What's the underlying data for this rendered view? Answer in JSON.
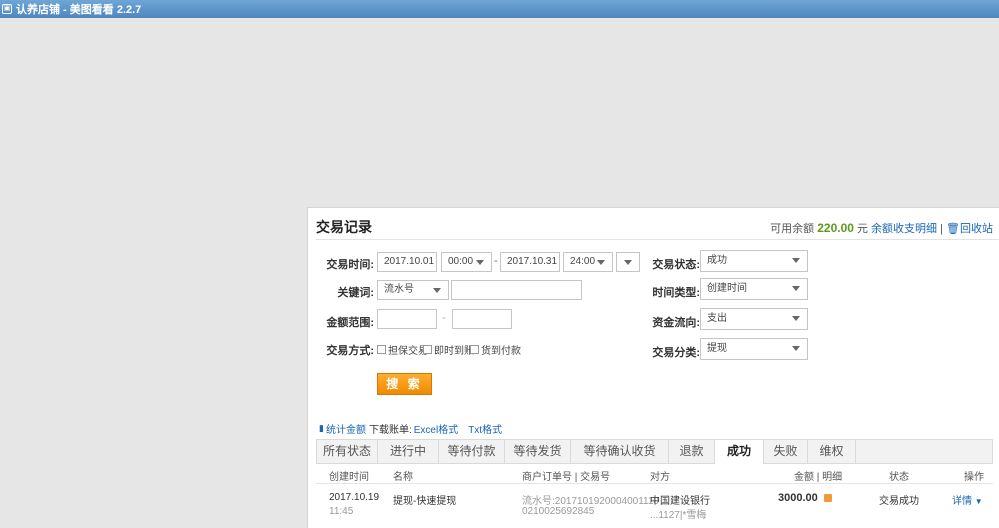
{
  "titlebar": {
    "icon": "app-icon",
    "title": "认养店铺 - 美图看看 2.2.7"
  },
  "page": {
    "title": "交易记录"
  },
  "balance": {
    "label": "可用余额",
    "amount": "220.00",
    "unit": "元",
    "link_detail": "余额收支明细",
    "separator": "|",
    "recycle_icon": "trash-icon",
    "link_recycle": "回收站"
  },
  "form": {
    "time_label": "交易时间:",
    "date_start": "2017.10.01",
    "time_start": "00:00",
    "dash": "-",
    "date_end": "2017.10.31",
    "time_end": "24:00",
    "status_label": "交易状态:",
    "status_value": "成功",
    "keyword_label": "关键词:",
    "keyword_type": "流水号",
    "keyword_value": "",
    "time_type_label": "时间类型:",
    "time_type_value": "创建时间",
    "amount_label": "金额范围:",
    "amount_min": "",
    "amount_max": "",
    "flow_label": "资金流向:",
    "flow_value": "支出",
    "method_label": "交易方式:",
    "methods": [
      "担保交易",
      "即时到账",
      "货到付款"
    ],
    "category_label": "交易分类:",
    "category_value": "提现",
    "search_button": "搜 索"
  },
  "stats": {
    "chart_icon": "bar-chart-icon",
    "stat_link": "统计金额",
    "download_label": "下载账单:",
    "excel_link": "Excel格式",
    "txt_link": "Txt格式"
  },
  "tabs": [
    "所有状态",
    "进行中",
    "等待付款",
    "等待发货",
    "等待确认收货",
    "退款",
    "成功",
    "失败",
    "维权"
  ],
  "active_tab": "成功",
  "table": {
    "headers": {
      "created": "创建时间",
      "name": "名称",
      "order": "商户订单号 | 交易号",
      "party": "对方",
      "amount": "金额 | 明细",
      "status": "状态",
      "action": "操作"
    },
    "rows": [
      {
        "date": "2017.10.19",
        "time": "11:45",
        "name": "提现-快速提现",
        "serial_line1": "流水号:2017101920004001110",
        "serial_line2": "0210025692845",
        "party_line1": "中国建设银行",
        "party_line2": "...1127|*雪梅",
        "amount": "3000.00",
        "status": "交易成功",
        "action": "详情"
      }
    ]
  }
}
